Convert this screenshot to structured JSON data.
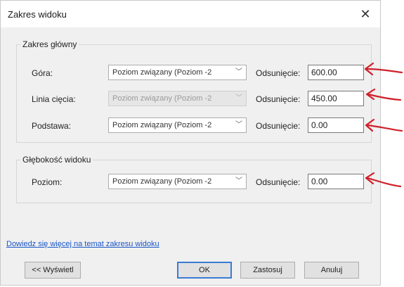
{
  "window": {
    "title": "Zakres widoku",
    "close_glyph": "✕"
  },
  "main_range": {
    "group_label": "Zakres główny",
    "rows": [
      {
        "label": "Góra:",
        "level": "Poziom związany (Poziom -2",
        "offset_label": "Odsunięcie:",
        "offset_value": "600.00",
        "disabled": false
      },
      {
        "label": "Linia cięcia:",
        "level": "Poziom związany (Poziom -2",
        "offset_label": "Odsunięcie:",
        "offset_value": "450.00",
        "disabled": true
      },
      {
        "label": "Podstawa:",
        "level": "Poziom związany (Poziom -2",
        "offset_label": "Odsunięcie:",
        "offset_value": "0.00",
        "disabled": false
      }
    ]
  },
  "view_depth": {
    "group_label": "Głębokość widoku",
    "row": {
      "label": "Poziom:",
      "level": "Poziom związany (Poziom -2",
      "offset_label": "Odsunięcie:",
      "offset_value": "0.00"
    }
  },
  "link_text": "Dowiedz się więcej na temat zakresu widoku",
  "buttons": {
    "show": "<< Wyświetl",
    "ok": "OK",
    "apply": "Zastosuj",
    "cancel": "Anuluj"
  },
  "annotation": {
    "arrow_color": "#d0202a",
    "icon": "hand-drawn-arrow-icon"
  },
  "icons": {
    "dropdown": "chevron-down-icon",
    "close": "close-icon"
  }
}
